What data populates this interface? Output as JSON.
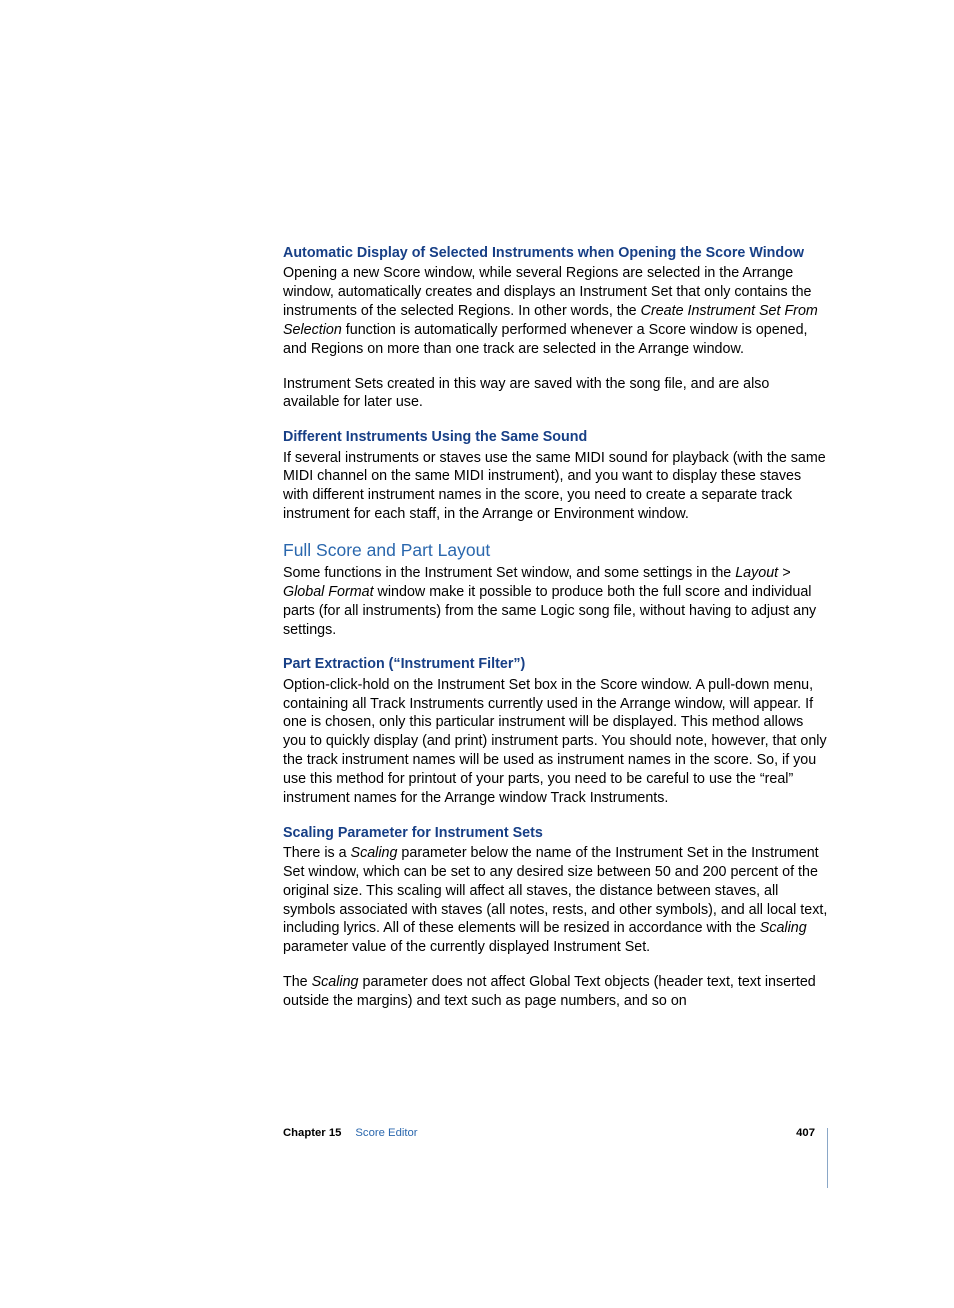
{
  "sections": {
    "autoDisplay": {
      "heading": "Automatic Display of Selected Instruments when Opening the Score Window",
      "p1a": "Opening a new Score window, while several Regions are selected in the Arrange window, automatically creates and displays an Instrument Set that only contains the instruments of the selected Regions. In other words, the ",
      "p1_em": "Create Instrument Set From Selection",
      "p1b": " function is automatically performed whenever a Score window is opened, and Regions on more than one track are selected in the Arrange window.",
      "p2": "Instrument Sets created in this way are saved with the song file, and are also available for later use."
    },
    "diffInstruments": {
      "heading": "Different Instruments Using the Same Sound",
      "p1": "If several instruments or staves use the same MIDI sound for playback (with the same MIDI channel on the same MIDI instrument), and you want to display these staves with different instrument names in the score, you need to create a separate track instrument for each staff, in the Arrange or Environment window."
    },
    "fullScore": {
      "title": "Full Score and Part Layout",
      "p1a": "Some functions in the Instrument Set window, and some settings in the ",
      "p1_em": "Layout > Global Format",
      "p1b": " window make it possible to produce both the full score and individual parts (for all instruments) from the same Logic song file, without having to adjust any settings."
    },
    "partExtraction": {
      "heading": "Part Extraction (“Instrument Filter”)",
      "p1": "Option-click-hold on the Instrument Set box in the Score window. A pull-down menu, containing all Track Instruments currently used in the Arrange window, will appear. If one is chosen, only this particular instrument will be displayed. This method allows you to quickly display (and print) instrument parts. You should note, however, that only the track instrument names will be used as instrument names in the score. So, if you use this method for printout of your parts, you need to be careful to use the “real” instrument names for the Arrange window Track Instruments."
    },
    "scaling": {
      "heading": "Scaling Parameter for Instrument Sets",
      "p1a": "There is a ",
      "p1_em1": "Scaling",
      "p1b": " parameter below the name of the Instrument Set in the Instrument Set window, which can be set to any desired size between 50 and 200 percent of the original size. This scaling will affect all staves, the distance between staves, all symbols associated with staves (all notes, rests, and other symbols), and all local text, including lyrics. All of these elements will be resized in accordance with the ",
      "p1_em2": "Scaling",
      "p1c": " parameter value of the currently displayed Instrument Set.",
      "p2a": "The ",
      "p2_em": "Scaling",
      "p2b": " parameter does not affect Global Text objects (header text, text inserted outside the margins) and text such as page numbers, and so on"
    }
  },
  "footer": {
    "chapterLabel": "Chapter 15",
    "chapterTitle": "Score Editor",
    "pageNumber": "407"
  }
}
